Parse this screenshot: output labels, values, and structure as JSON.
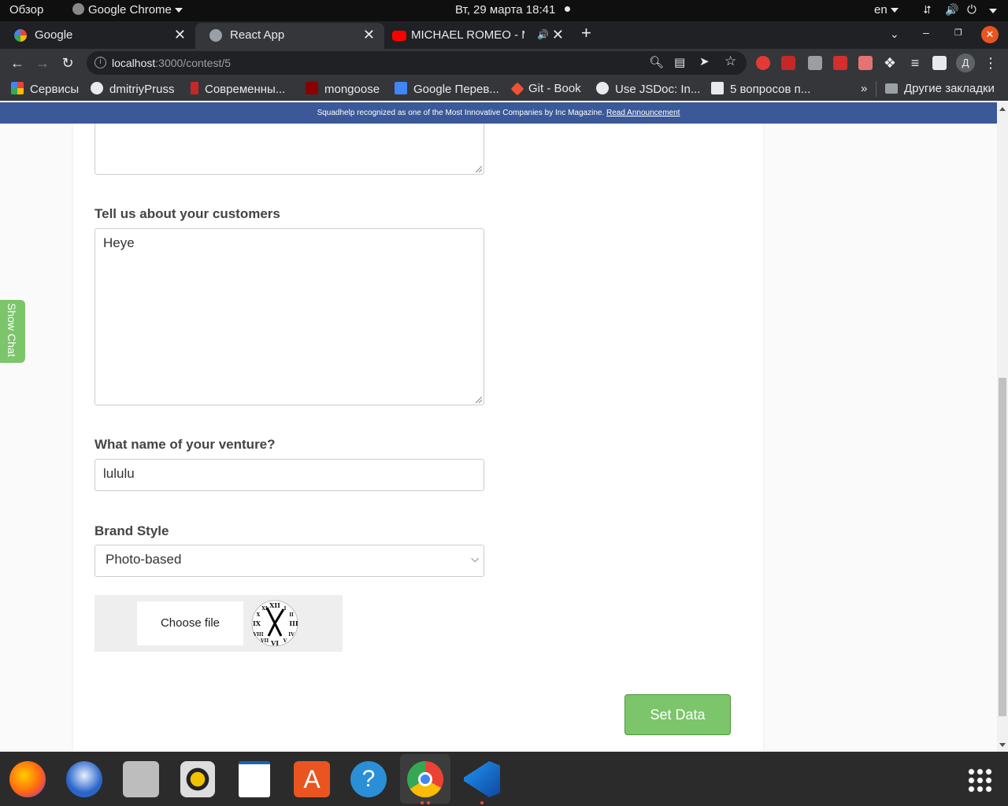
{
  "system_bar": {
    "overview": "Обзор",
    "app_name": "Google Chrome",
    "clock": "Вт, 29 марта  18:41",
    "lang": "en"
  },
  "tabs": [
    {
      "title": "Google"
    },
    {
      "title": "React App"
    },
    {
      "title": "MICHAEL ROMEO - Me"
    }
  ],
  "address_bar": {
    "host": "localhost",
    "path": ":3000/contest/5"
  },
  "profile_initial": "Д",
  "bookmarks": [
    "Сервисы",
    "dmitriyPruss",
    "Современны...",
    "mongoose",
    "Google Перев...",
    "Git - Book",
    "Use JSDoc: In...",
    "5 вопросов п..."
  ],
  "bookmarks_overflow": "»",
  "other_bookmarks": "Другие закладки",
  "announcement": {
    "text": "Squadhelp recognized as one of the Most Innovative Companies by Inc Magazine.",
    "link": "Read Announcement"
  },
  "form": {
    "customers_label": "Tell us about your customers",
    "customers_value": "Heye",
    "venture_label": "What name of your venture?",
    "venture_value": "lululu",
    "brand_label": "Brand Style",
    "brand_value": "Photo-based",
    "choose_file": "Choose file",
    "submit": "Set Data"
  },
  "show_chat": "Show Chat",
  "colors": {
    "accent_green": "#7cc56a",
    "announce_blue": "#3b5998"
  }
}
